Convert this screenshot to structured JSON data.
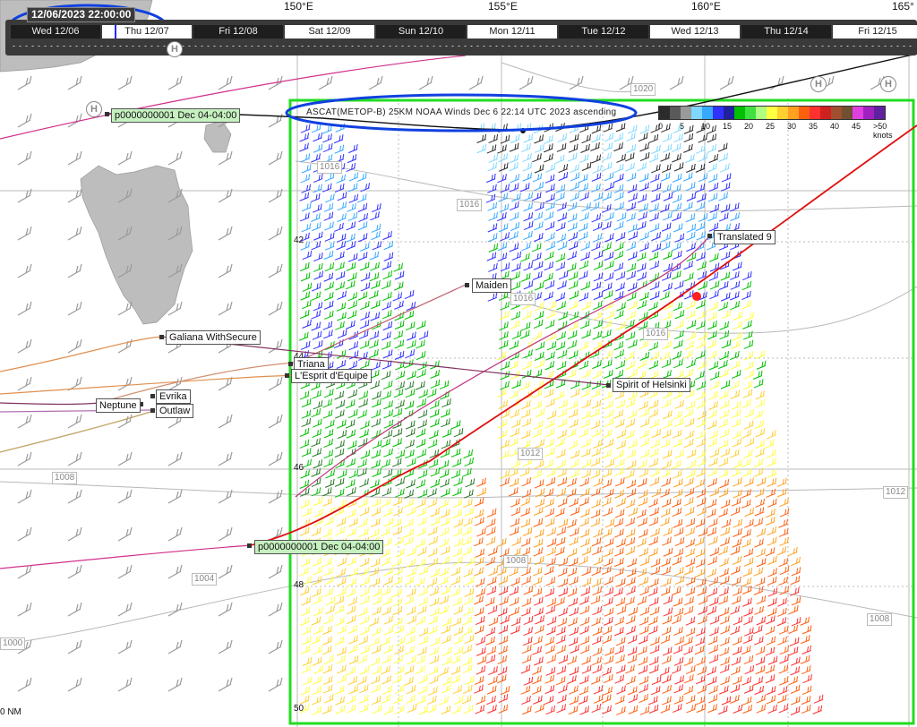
{
  "timeline": {
    "current_time": "12/06/2023 22:00:00",
    "days": [
      "Wed 12/06",
      "Thu 12/07",
      "Fri 12/08",
      "Sat 12/09",
      "Sun 12/10",
      "Mon 12/11",
      "Tue 12/12",
      "Wed 12/13",
      "Thu 12/14",
      "Fri 12/15"
    ],
    "cursor_fraction": 0.1
  },
  "longitudes": [
    "150°E",
    "155°E",
    "160°E",
    "165°"
  ],
  "overlay": {
    "title": "ASCAT(METOP-B) 25KM NOAA Winds Dec  6 22:14 UTC 2023 ascending",
    "legend_ticks": [
      "0",
      "5",
      "10",
      "15",
      "20",
      "25",
      "30",
      "35",
      "40",
      "45",
      ">50 knots"
    ],
    "legend_colors": [
      "#2b2b2b",
      "#5a5a5a",
      "#9a9a9a",
      "#7fd8ff",
      "#37a8ff",
      "#3030ff",
      "#2020a0",
      "#00c000",
      "#40e040",
      "#b0ff80",
      "#ffff40",
      "#ffd030",
      "#ffa020",
      "#ff6010",
      "#ff3030",
      "#d02020",
      "#a05030",
      "#705030",
      "#e040e0",
      "#a020c0",
      "#6020a0"
    ]
  },
  "boats": [
    {
      "name": "p0000000001 Dec 04-04:00",
      "style": "green"
    },
    {
      "name": "Translated 9"
    },
    {
      "name": "Maiden"
    },
    {
      "name": "Galiana WithSecure"
    },
    {
      "name": "Triana"
    },
    {
      "name": "L'Esprit d'Equipe"
    },
    {
      "name": "Spirit of Helsinki"
    },
    {
      "name": "Evrika"
    },
    {
      "name": "Neptune"
    },
    {
      "name": "Outlaw"
    },
    {
      "name": "p0000000001 Dec 04-04:00",
      "style": "green"
    }
  ],
  "isobars": [
    "1016",
    "1016",
    "1016",
    "1016",
    "1020",
    "1012",
    "1012",
    "1008",
    "1008",
    "1008",
    "1004",
    "1000"
  ],
  "latitudes": [
    "42",
    "44",
    "46",
    "48",
    "50"
  ],
  "high_marker": "H",
  "scale": "0 NM",
  "colors": {
    "overlay_border": "#22dd22",
    "annotation": "#1040e0",
    "route_red": "#e01010",
    "land": "#bdbdbd"
  }
}
